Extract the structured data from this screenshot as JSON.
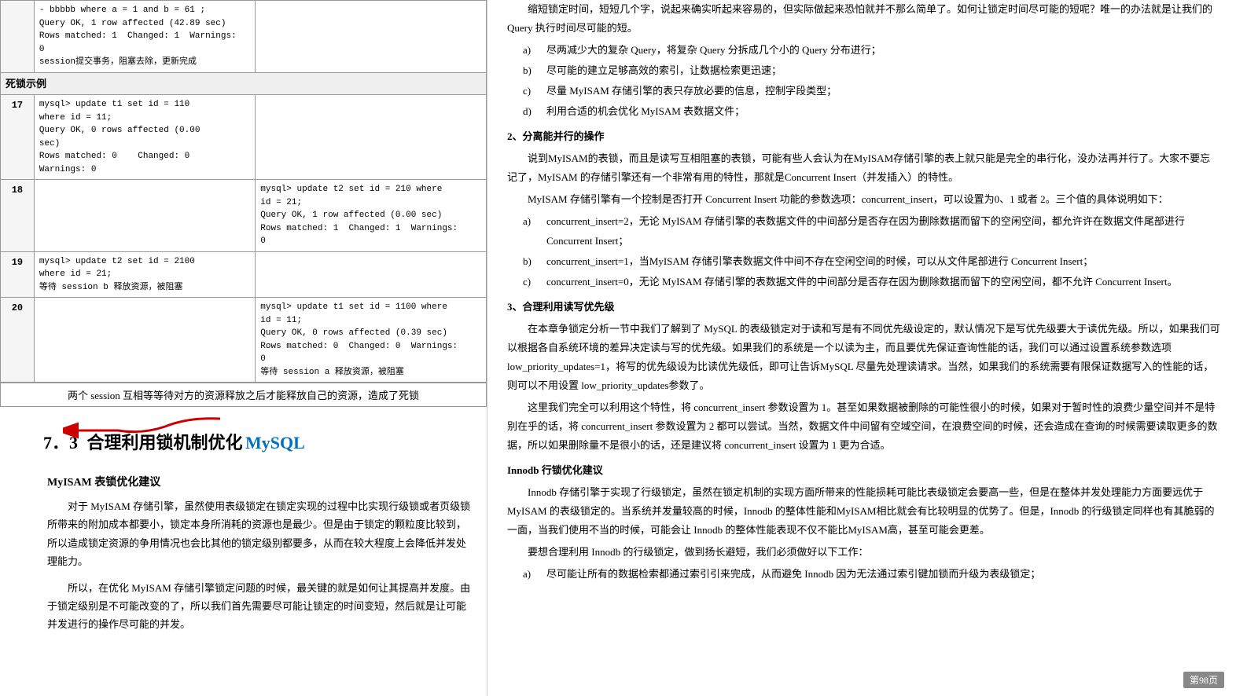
{
  "left": {
    "table": {
      "rows": [
        {
          "id": "",
          "sessionA": "- bbbbb where a = 1 and b = 61 ;\nQuery OK, 1 row affected (42.89 sec)\nRows matched: 1  Changed: 1  Warnings:\n0\nsession提交事务，阻塞去除，更新完成",
          "sessionB": ""
        },
        {
          "id": "死锁示例",
          "isHeader": true
        },
        {
          "id": "17",
          "sessionA": "mysql> update t1 set id = 110\nwhere id = 11;\nQuery OK, 0 rows affected (0.00\nsec)\nRows matched: 0    Changed: 0\nWarnings: 0",
          "sessionB": ""
        },
        {
          "id": "18",
          "sessionA": "",
          "sessionB": "mysql> update t2 set id = 210 where\nid = 21;\nQuery OK, 1 row affected (0.00 sec)\nRows matched: 1  Changed: 1  Warnings:\n0"
        },
        {
          "id": "19",
          "sessionA": "mysql> update t2 set id = 2100\nwhere id = 21;\n等待 session b 释放资源，被阻塞",
          "sessionB": ""
        },
        {
          "id": "20",
          "sessionA": "",
          "sessionB": "mysql> update t1 set id = 1100 where\nid = 11;\nQuery OK, 0 rows affected (0.39 sec)\nRows matched: 0  Changed: 0  Warnings:\n0\n等待 session a 释放资源，被阻塞"
        }
      ],
      "bottomNote": "两个 session 互相等等待对方的资源释放之后才能释放自己的资源，造成了死锁"
    },
    "sectionNumber": "7．3",
    "sectionTitle": "合理利用锁机制优化",
    "sectionTitleHighlight": "MySQL",
    "myisamHeading": "MyISAM 表锁优化建议",
    "bodyText1": "对于 MyISAM 存储引擎，虽然使用表级锁定在锁定实现的过程中比实现行级锁或者页级锁所带来的附加成本都要小，锁定本身所消耗的资源也是最少。但是由于锁定的颗粒度比较到，所以造成锁定资源的争用情况也会比其他的锁定级别都要多，从而在较大程度上会降低并发处理能力。",
    "bodyText2": "所以，在优化 MyISAM 存储引擎锁定问题的时候，最关键的就是如何让其提高并发度。由于锁定级别是不可能改变的了，所以我们首先需要尽可能让锁定的时间变短，然后就是让可能并发进行的操作尽可能的并发。"
  },
  "right": {
    "introText": "缩短锁定时间，短短几个字，说起来确实听起来容易的，但实际做起来恐怕就并不那么简单了。如何让锁定时间尽可能的短呢？唯一的办法就是让我们的 Query 执行时间尽可能的短。",
    "listItems": [
      {
        "label": "a)",
        "text": "尽两减少大的复杂 Query，将复杂 Query 分拆成几个小的 Query 分布进行；"
      },
      {
        "label": "b)",
        "text": "尽可能的建立足够高效的索引，让数据检索更迅速；"
      },
      {
        "label": "c)",
        "text": "尽量 MyISAM 存储引擎的表只存放必要的信息，控制字段类型；"
      },
      {
        "label": "d)",
        "text": "利用合适的机会优化 MyISAM 表数据文件；"
      }
    ],
    "section2Title": "2、分离能并行的操作",
    "section2Text1": "说到MyISAM的表锁，而且是读写互相阻塞的表锁，可能有些人会认为在MyISAM存储引擎的表上就只能是完全的串行化，没办法再并行了。大家不要忘记了，MyISAM 的存储引擎还有一个非常有用的特性，那就是Concurrent Insert（并发插入）的特性。",
    "section2Text2": "MyISAM 存储引擎有一个控制是否打开 Concurrent Insert 功能的参数选项：concurrent_insert，可以设置为0、1 或者 2。三个值的具体说明如下：",
    "concurrentItems": [
      {
        "label": "a)",
        "text": "concurrent_insert=2，无论 MyISAM 存储引擎的表数据文件的中间部分是否存在因为删除数据而留下的空闲空间，都允许许在数据文件尾部进行 Concurrent Insert；"
      },
      {
        "label": "b)",
        "text": "concurrent_insert=1，当MyISAM 存储引擎表数据文件中间不存在空闲空间的时候，可以从文件尾部进行 Concurrent Insert；"
      },
      {
        "label": "c)",
        "text": "concurrent_insert=0，无论 MyISAM 存储引擎的表数据文件的中间部分是否存在因为删除数据而留下的空闲空间，都不允许 Concurrent Insert。"
      }
    ],
    "section3Title": "3、合理利用读写优先级",
    "section3Text1": "在本章争锁定分析一节中我们了解到了 MySQL 的表级锁定对于读和写是有不同优先级设定的，默认情况下是写优先级要大于读优先级。所以，如果我们可以根据各自系统环境的差异决定读与写的优先级。如果我们的系统是一个以读为主，而且要优先保证查询性能的话，我们可以通过设置系统参数选项low_priority_updates=1，将写的优先级设为比读优先级低，即可让告诉MySQL 尽量先处理读请求。当然，如果我们的系统需要有限保证数据写入的性能的话，则可以不用设置 low_priority_updates参数了。",
    "section3Text2": "这里我们完全可以利用这个特性，将 concurrent_insert 参数设置为 1。甚至如果数据被删除的可能性很小的时候，如果对于暂时性的浪费少量空间并不是特别在乎的话，将 concurrent_insert 参数设置为 2 都可以尝试。当然，数据文件中间留有空域空间，在浪费空间的时候，还会造成在查询的时候需要读取更多的数据，所以如果删除量不是很小的话，还是建议将 concurrent_insert 设置为 1 更为合适。",
    "innodbTitle": "Innodb 行锁优化建议",
    "innodbText1": "Innodb 存储引擎于实现了行级锁定，虽然在锁定机制的实现方面所带来的性能损耗可能比表级锁定会要高一些，但是在整体并发处理能力方面要远优于 MyISAM 的表级锁定的。当系统并发量较高的时候，Innodb 的整体性能和MyISAM相比就会有比较明显的优势了。但是，Innodb 的行级锁定同样也有其脆弱的一面，当我们使用不当的时候，可能会让 Innodb 的整体性能表现不仅不能比MyISAM高，甚至可能会更差。",
    "innodbText2": "要想合理利用 Innodb 的行级锁定，做到扬长避短，我们必须做好以下工作：",
    "innodbList": [
      {
        "label": "a)",
        "text": "尽可能让所有的数据检索都通过索引引来完成，从而避免 Innodb 因为无法通过索引键加锁而升级为表级锁定；"
      }
    ],
    "pageNum": "第98页"
  }
}
